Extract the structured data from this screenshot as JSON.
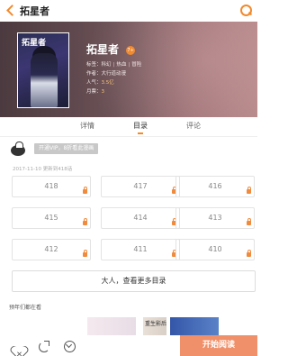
{
  "header": {
    "title": "拓星者",
    "back_icon": "chevron-left-icon",
    "search_icon": "search-icon",
    "accent_color": "#f28a2e"
  },
  "book": {
    "cover_title": "拓星者",
    "name": "拓星者",
    "age_badge": "7+",
    "tags_label": "标签：",
    "tags": [
      "科幻",
      "热血",
      "冒险"
    ],
    "author": "作者：大行道动漫",
    "popularity_label": "人气：",
    "popularity_value": "3.5亿",
    "monthly_ticket_label": "月票：",
    "monthly_ticket_value": "3"
  },
  "tabs": [
    {
      "label": "详情",
      "active": false
    },
    {
      "label": "目录",
      "active": true
    },
    {
      "label": "评论",
      "active": false
    }
  ],
  "vip": {
    "banner": "开通VIP，8折看此漫画"
  },
  "update_line": "2017-11-10 更新到418话",
  "chapters": [
    "418",
    "417",
    "416",
    "415",
    "414",
    "413",
    "412",
    "411",
    "410"
  ],
  "more_button": "大人，查看更多目录",
  "also_watching_title": "预年们都在看",
  "thumbnail_2_text": "重生影后",
  "bottom": {
    "start_button": "开始阅读",
    "icons": [
      "heart-icon",
      "share-icon",
      "download-icon"
    ]
  }
}
